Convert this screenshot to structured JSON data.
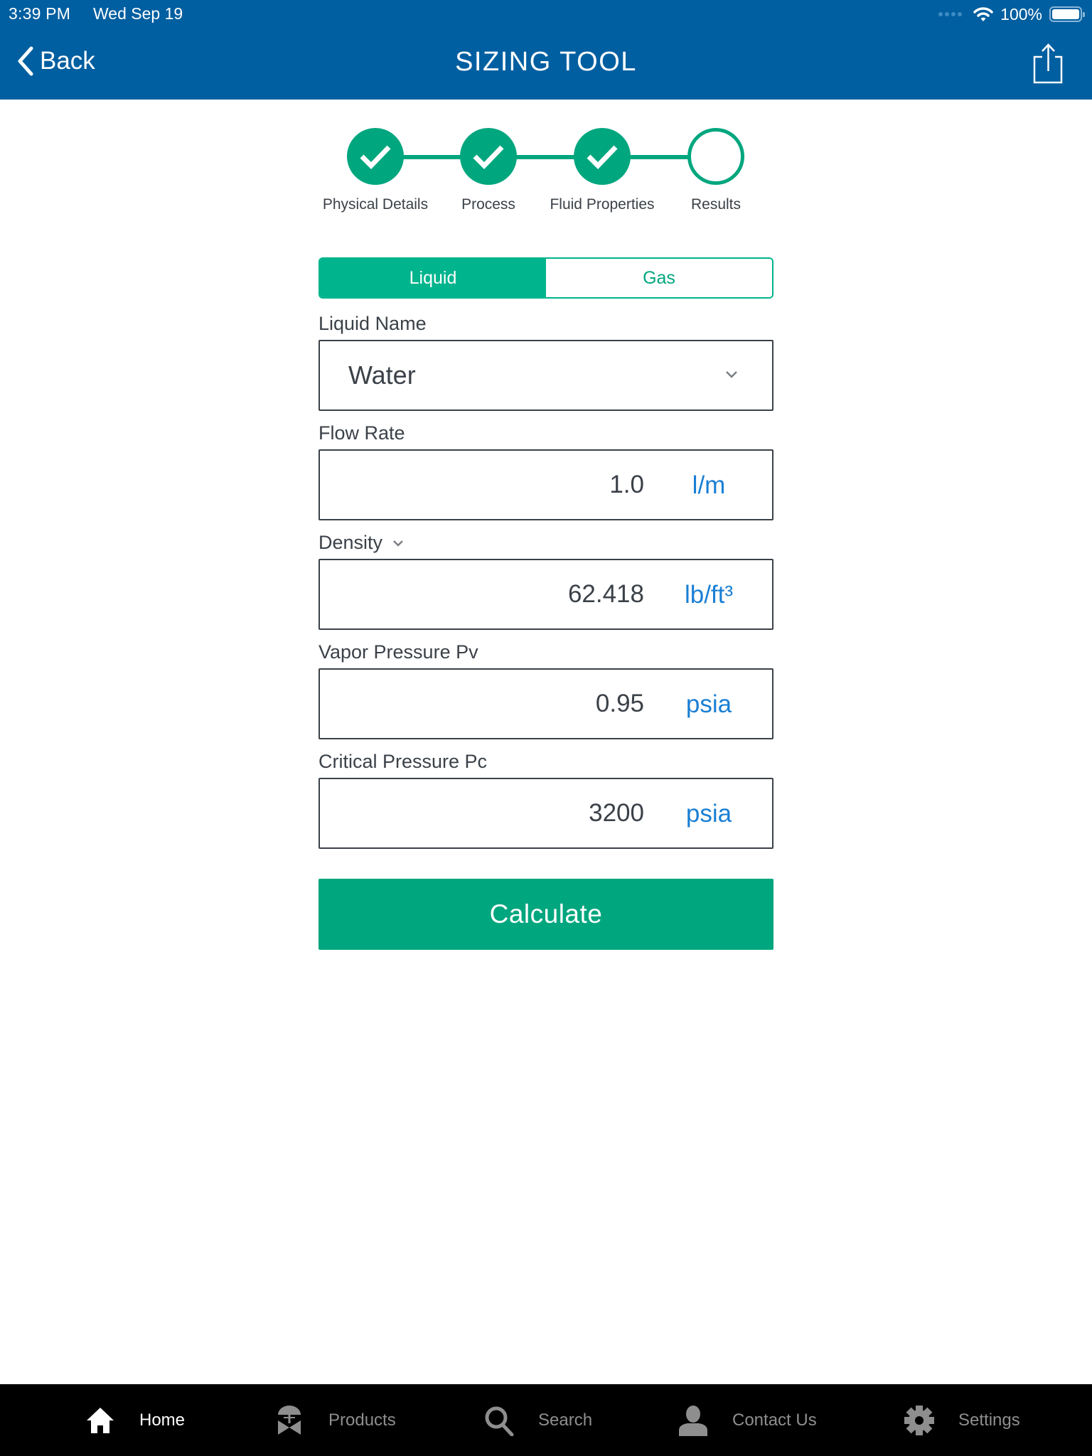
{
  "status_bar": {
    "time": "3:39 PM",
    "date": "Wed Sep 19",
    "battery_percent": "100%",
    "battery_level": 1.0
  },
  "nav": {
    "back_label": "Back",
    "title": "SIZING TOOL",
    "share_icon": "share-icon"
  },
  "stepper": {
    "steps": [
      {
        "label": "Physical Details",
        "state": "complete"
      },
      {
        "label": "Process",
        "state": "complete"
      },
      {
        "label": "Fluid Properties",
        "state": "complete"
      },
      {
        "label": "Results",
        "state": "incomplete"
      }
    ]
  },
  "fluid_type": {
    "options": [
      "Liquid",
      "Gas"
    ],
    "selected": "Liquid"
  },
  "form": {
    "liquid_name": {
      "label": "Liquid Name",
      "value": "Water"
    },
    "flow_rate": {
      "label": "Flow Rate",
      "value": "1.0",
      "unit": "l/m"
    },
    "density": {
      "label": "Density",
      "value": "62.418",
      "unit": "lb/ft³"
    },
    "vapor_pressure": {
      "label": "Vapor Pressure Pv",
      "value": "0.95",
      "unit": "psia"
    },
    "critical_pressure": {
      "label": "Critical Pressure Pc",
      "value": "3200",
      "unit": "psia"
    }
  },
  "calculate_label": "Calculate",
  "tabbar": {
    "items": [
      {
        "label": "Home",
        "icon": "home-icon",
        "active": true
      },
      {
        "label": "Products",
        "icon": "valve-icon",
        "active": false
      },
      {
        "label": "Search",
        "icon": "search-icon",
        "active": false
      },
      {
        "label": "Contact Us",
        "icon": "person-icon",
        "active": false
      },
      {
        "label": "Settings",
        "icon": "gear-icon",
        "active": false
      }
    ]
  },
  "colors": {
    "header_blue": "#005fa0",
    "accent_green": "#00a67e",
    "segment_green": "#00b48d",
    "unit_blue": "#1a7fd4",
    "tabbar_bg": "#000000"
  }
}
